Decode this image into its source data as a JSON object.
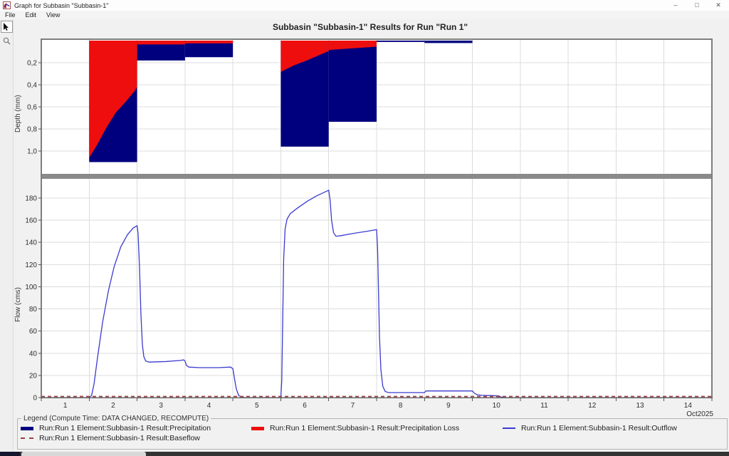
{
  "window": {
    "title": "Graph for Subbasin \"Subbasin-1\"",
    "controls": {
      "minimize": "–",
      "maximize": "□",
      "close": "✕"
    }
  },
  "menu": {
    "items": [
      "File",
      "Edit",
      "View"
    ]
  },
  "toolbar": {
    "tools": [
      "pointer-tool",
      "zoom-tool"
    ]
  },
  "chart_data": {
    "type": "combo",
    "title": "Subbasin \"Subbasin-1\" Results for Run \"Run 1\"",
    "x_axis": {
      "range_days": [
        0,
        14
      ],
      "day_labels": [
        "1",
        "2",
        "3",
        "4",
        "5",
        "6",
        "7",
        "8",
        "9",
        "10",
        "11",
        "12",
        "13",
        "14"
      ],
      "unit_label": "Oct2025",
      "grid": true
    },
    "depth_panel": {
      "type": "bar",
      "ylabel": "Depth (mm)",
      "ylim": [
        0,
        1.21
      ],
      "inverted": true,
      "yticks": [
        {
          "v": 0.2,
          "label": "0,2"
        },
        {
          "v": 0.4,
          "label": "0,4"
        },
        {
          "v": 0.6,
          "label": "0,6"
        },
        {
          "v": 0.8,
          "label": "0,8"
        },
        {
          "v": 1.0,
          "label": "1,0"
        }
      ],
      "precipitation_bars": [
        {
          "t0": 1.0,
          "t1": 2.0,
          "depth": 1.1
        },
        {
          "t0": 2.0,
          "t1": 3.0,
          "depth": 0.18
        },
        {
          "t0": 3.0,
          "t1": 4.0,
          "depth": 0.15
        },
        {
          "t0": 5.0,
          "t1": 6.0,
          "depth": 0.96
        },
        {
          "t0": 6.0,
          "t1": 7.0,
          "depth": 0.735
        },
        {
          "t0": 7.0,
          "t1": 8.0,
          "depth": 0.012
        },
        {
          "t0": 8.0,
          "t1": 9.0,
          "depth": 0.022
        }
      ],
      "loss_areas": [
        {
          "points": [
            [
              1.0,
              1.06
            ],
            [
              1.17,
              0.94
            ],
            [
              1.37,
              0.78
            ],
            [
              1.56,
              0.65
            ],
            [
              1.77,
              0.55
            ],
            [
              1.96,
              0.45
            ],
            [
              2.0,
              0.42
            ]
          ]
        },
        {
          "points": [
            [
              2.0,
              0.035
            ],
            [
              3.0,
              0.035
            ]
          ]
        },
        {
          "points": [
            [
              3.0,
              0.025
            ],
            [
              4.0,
              0.025
            ]
          ]
        },
        {
          "points": [
            [
              5.0,
              0.284
            ],
            [
              5.27,
              0.225
            ],
            [
              5.57,
              0.175
            ],
            [
              5.78,
              0.135
            ],
            [
              6.0,
              0.095
            ]
          ]
        },
        {
          "points": [
            [
              6.0,
              0.085
            ],
            [
              7.0,
              0.055
            ]
          ]
        }
      ]
    },
    "flow_panel": {
      "type": "line",
      "ylabel": "Flow (cms)",
      "ylim": [
        0,
        197
      ],
      "yticks": [
        {
          "v": 0,
          "label": "0"
        },
        {
          "v": 20,
          "label": "20"
        },
        {
          "v": 40,
          "label": "40"
        },
        {
          "v": 60,
          "label": "60"
        },
        {
          "v": 80,
          "label": "80"
        },
        {
          "v": 100,
          "label": "100"
        },
        {
          "v": 120,
          "label": "120"
        },
        {
          "v": 140,
          "label": "140"
        },
        {
          "v": 160,
          "label": "160"
        },
        {
          "v": 180,
          "label": "180"
        }
      ],
      "outflow_points": [
        [
          0,
          0
        ],
        [
          1.0,
          0
        ],
        [
          1.05,
          2
        ],
        [
          1.1,
          12
        ],
        [
          1.18,
          38
        ],
        [
          1.28,
          68
        ],
        [
          1.4,
          96
        ],
        [
          1.52,
          118
        ],
        [
          1.66,
          136
        ],
        [
          1.8,
          147
        ],
        [
          1.92,
          153
        ],
        [
          2.0,
          155
        ],
        [
          2.02,
          148
        ],
        [
          2.05,
          118
        ],
        [
          2.08,
          75
        ],
        [
          2.11,
          48
        ],
        [
          2.14,
          37
        ],
        [
          2.18,
          33
        ],
        [
          2.25,
          32
        ],
        [
          2.6,
          32.5
        ],
        [
          2.9,
          33.5
        ],
        [
          2.97,
          34
        ],
        [
          3.0,
          33
        ],
        [
          3.03,
          29
        ],
        [
          3.08,
          27.5
        ],
        [
          3.3,
          27
        ],
        [
          3.7,
          27
        ],
        [
          3.95,
          27.5
        ],
        [
          4.0,
          26
        ],
        [
          4.03,
          18
        ],
        [
          4.07,
          8
        ],
        [
          4.12,
          2
        ],
        [
          4.18,
          0.5
        ],
        [
          4.25,
          0
        ],
        [
          5.0,
          0
        ],
        [
          5.02,
          15
        ],
        [
          5.04,
          70
        ],
        [
          5.06,
          125
        ],
        [
          5.09,
          152
        ],
        [
          5.13,
          161
        ],
        [
          5.2,
          166
        ],
        [
          5.35,
          171
        ],
        [
          5.55,
          177
        ],
        [
          5.75,
          182
        ],
        [
          5.95,
          186
        ],
        [
          6.0,
          187
        ],
        [
          6.03,
          178
        ],
        [
          6.06,
          160
        ],
        [
          6.1,
          149
        ],
        [
          6.15,
          145.5
        ],
        [
          6.25,
          146
        ],
        [
          6.5,
          148
        ],
        [
          6.8,
          150
        ],
        [
          7.0,
          151.5
        ],
        [
          7.02,
          135
        ],
        [
          7.04,
          95
        ],
        [
          7.06,
          55
        ],
        [
          7.09,
          25
        ],
        [
          7.13,
          10
        ],
        [
          7.18,
          5.5
        ],
        [
          7.25,
          4.5
        ],
        [
          7.6,
          4.5
        ],
        [
          8.0,
          4.5
        ],
        [
          8.03,
          6
        ],
        [
          8.4,
          6
        ],
        [
          8.9,
          6
        ],
        [
          9.0,
          6
        ],
        [
          9.04,
          4
        ],
        [
          9.1,
          2.5
        ],
        [
          9.2,
          2
        ],
        [
          9.4,
          1.8
        ],
        [
          9.55,
          1.5
        ],
        [
          9.6,
          0.5
        ],
        [
          9.7,
          0
        ],
        [
          14,
          0
        ]
      ],
      "baseflow_points": [
        [
          0,
          0
        ],
        [
          14,
          0
        ]
      ]
    },
    "colors": {
      "precipitation": "#00007e",
      "loss": "#ee0e0e",
      "outflow": "#3b3bcf",
      "baseflow": "#9b4040",
      "grid": "#dcdcdc",
      "frame": "#7e7e7e"
    }
  },
  "legend": {
    "title": "Legend (Compute Time: DATA CHANGED, RECOMPUTE)",
    "items": [
      {
        "label": "Run:Run 1 Element:Subbasin-1 Result:Precipitation",
        "swatch": "thick-navy"
      },
      {
        "label": "Run:Run 1 Element:Subbasin-1 Result:Precipitation Loss",
        "swatch": "thick-red"
      },
      {
        "label": "Run:Run 1 Element:Subbasin-1 Result:Outflow",
        "swatch": "thin-blue"
      },
      {
        "label": "Run:Run 1 Element:Subbasin-1 Result:Baseflow",
        "swatch": "dashed-maroon"
      }
    ]
  }
}
